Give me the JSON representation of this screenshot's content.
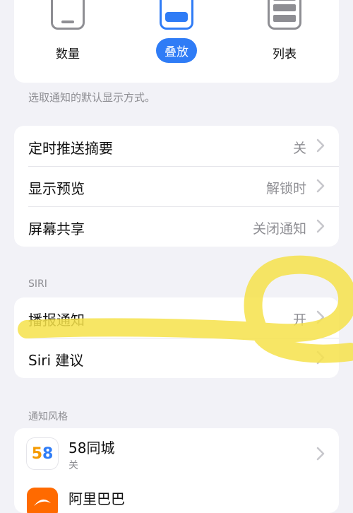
{
  "style_options": [
    {
      "label": "数量",
      "selected": false,
      "icon": "phone-count-icon"
    },
    {
      "label": "叠放",
      "selected": true,
      "icon": "phone-stack-icon"
    },
    {
      "label": "列表",
      "selected": false,
      "icon": "phone-list-icon"
    }
  ],
  "style_footnote": "选取通知的默认显示方式。",
  "general_rows": [
    {
      "label": "定时推送摘要",
      "value": "关"
    },
    {
      "label": "显示预览",
      "value": "解锁时"
    },
    {
      "label": "屏幕共享",
      "value": "关闭通知"
    }
  ],
  "siri": {
    "header": "SIRI",
    "rows": [
      {
        "label": "播报通知",
        "value": "开"
      },
      {
        "label": "Siri 建议",
        "value": ""
      }
    ]
  },
  "notification_style": {
    "header": "通知风格",
    "apps": [
      {
        "name": "58同城",
        "status": "关",
        "icon_text": "58"
      },
      {
        "name": "阿里巴巴",
        "status": "",
        "icon_text": ""
      }
    ]
  },
  "colors": {
    "accent": "#2f7cf6",
    "highlight": "#f6e24a"
  }
}
